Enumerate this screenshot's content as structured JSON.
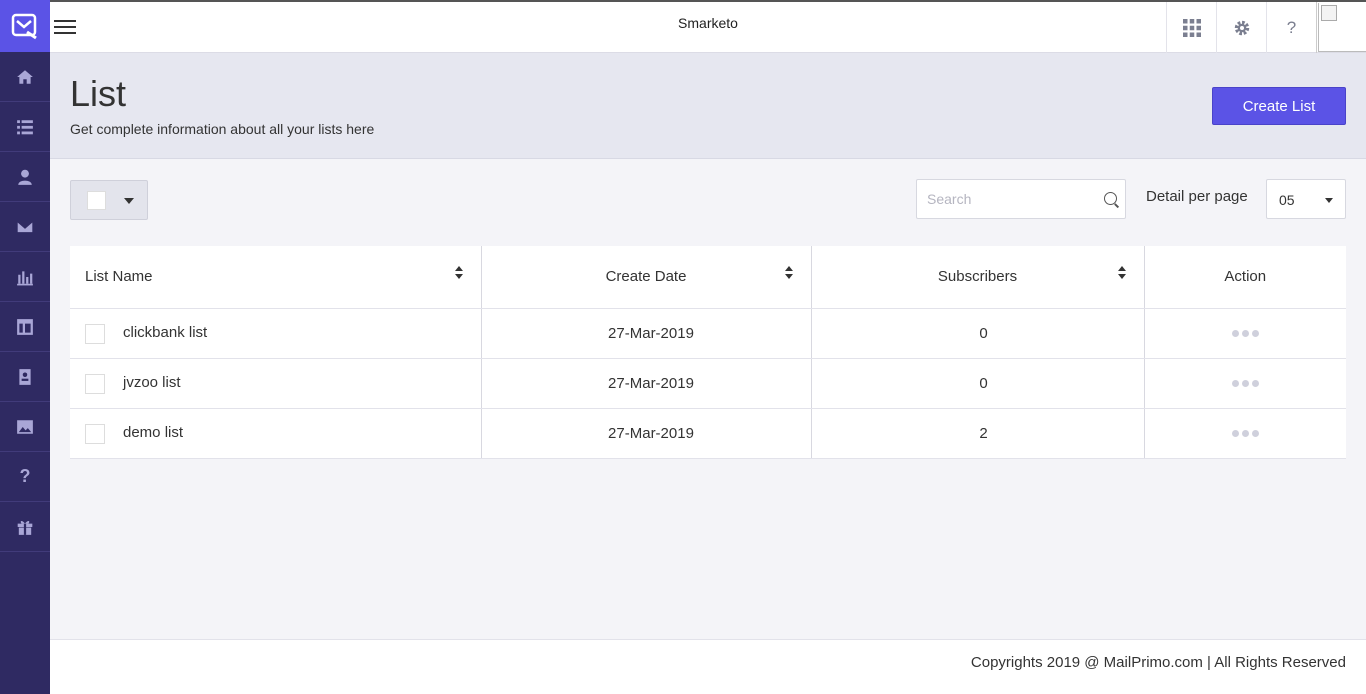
{
  "app": {
    "title": "Smarketo"
  },
  "sidebar": {
    "items": [
      {
        "icon": "home-icon"
      },
      {
        "icon": "list-icon"
      },
      {
        "icon": "user-icon"
      },
      {
        "icon": "mail-icon"
      },
      {
        "icon": "bar-chart-icon"
      },
      {
        "icon": "layout-icon"
      },
      {
        "icon": "contact-book-icon"
      },
      {
        "icon": "image-icon"
      },
      {
        "icon": "help-icon",
        "glyph": "?"
      },
      {
        "icon": "gift-icon"
      }
    ]
  },
  "topbar": {
    "help_glyph": "?"
  },
  "header": {
    "title": "List",
    "subtitle": "Get complete information about all your lists here",
    "create_button": "Create List"
  },
  "toolbar": {
    "search_placeholder": "Search",
    "per_page_label": "Detail per page",
    "per_page_value": "05"
  },
  "table": {
    "columns": [
      "List Name",
      "Create Date",
      "Subscribers",
      "Action"
    ],
    "rows": [
      {
        "name": "clickbank list",
        "date": "27-Mar-2019",
        "subscribers": "0"
      },
      {
        "name": "jvzoo list",
        "date": "27-Mar-2019",
        "subscribers": "0"
      },
      {
        "name": "demo list",
        "date": "27-Mar-2019",
        "subscribers": "2"
      }
    ]
  },
  "footer": {
    "copyright": "Copyrights 2019 @  MailPrimo.com | All Rights Reserved"
  },
  "colors": {
    "accent": "#5b53e6",
    "sidebar": "#2f2a62",
    "header_bg": "#e6e7f0"
  }
}
